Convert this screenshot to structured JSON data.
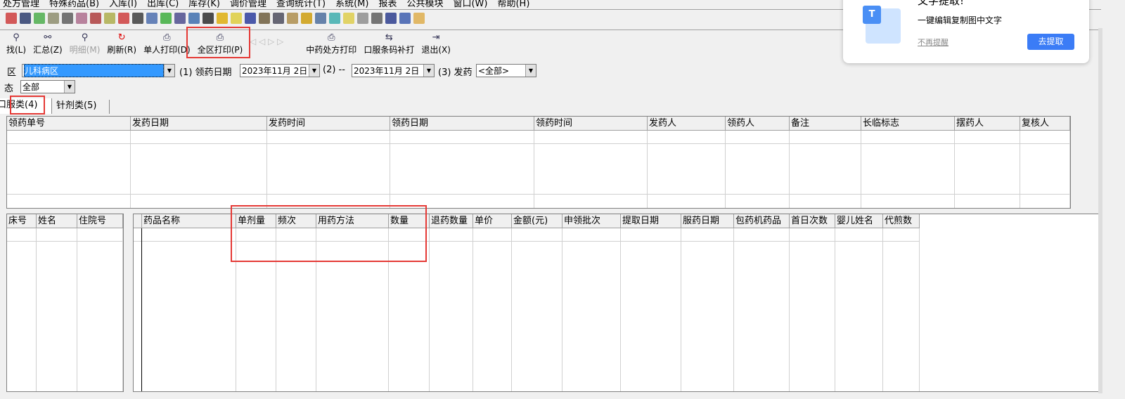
{
  "menu": [
    "处方管理",
    "特殊药品(B)",
    "入库(I)",
    "出库(C)",
    "库存(K)",
    "调价管理",
    "查询统计(T)",
    "系统(M)",
    "报表",
    "公共模块",
    "窗口(W)",
    "帮助(H)"
  ],
  "toolbar": [
    {
      "icon": "search-icon",
      "label": "找(L)",
      "enabled": true
    },
    {
      "icon": "binoculars-icon",
      "label": "汇总(Z)",
      "enabled": true
    },
    {
      "icon": "detail-icon",
      "label": "明细(M)",
      "enabled": false
    },
    {
      "icon": "refresh-icon",
      "label": "刷新(R)",
      "enabled": true
    },
    {
      "icon": "printer-icon",
      "label": "单人打印(D)",
      "enabled": true
    },
    {
      "icon": "printer-icon",
      "label": "全区打印(P)",
      "enabled": true
    },
    {
      "icon": "printer-icon",
      "label": "中药处方打印",
      "enabled": true
    },
    {
      "icon": "barcode-icon",
      "label": "口服条码补打",
      "enabled": true
    },
    {
      "icon": "exit-icon",
      "label": "退出(X)",
      "enabled": true
    }
  ],
  "filters": {
    "ward_label": "区",
    "ward_value": "儿科病区",
    "date_label": "(1) 领药日期",
    "date_from": "2023年11月 2日",
    "to_label": "(2) --",
    "date_to": "2023年11月 2日",
    "dispense_label": "(3) 发药",
    "dispense_value": "<全部>",
    "status_label": "态",
    "status_value": "全部"
  },
  "tabs": [
    "口服类(4)",
    "针剂类(5)"
  ],
  "top_grid": {
    "columns": [
      "领药单号",
      "发药日期",
      "发药时间",
      "领药日期",
      "领药时间",
      "发药人",
      "领药人",
      "备注",
      "长临标志",
      "摆药人",
      "复核人"
    ]
  },
  "patient_grid": {
    "columns": [
      "床号",
      "姓名",
      "住院号"
    ]
  },
  "drug_grid": {
    "columns": [
      "药品名称",
      "单剂量",
      "频次",
      "用药方法",
      "数量",
      "退药数量",
      "单价",
      "金额(元)",
      "申领批次",
      "提取日期",
      "服药日期",
      "包药机药品",
      "首日次数",
      "婴儿姓名",
      "代煎数"
    ]
  },
  "popup": {
    "title": "文字提取!",
    "text": "一键编辑复制图中文字",
    "dismiss": "不再提醒",
    "action": "去提取",
    "accent": "#3b82f6"
  }
}
